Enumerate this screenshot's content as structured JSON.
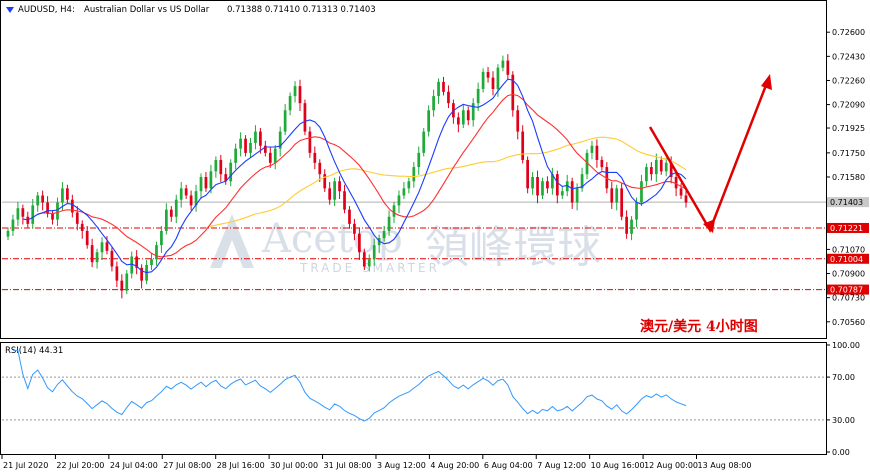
{
  "header": {
    "symbol": "AUDUSD, H4:",
    "description": "Australian Dollar vs US Dollar",
    "ohlc": "0.71388 0.71410 0.71313 0.71403"
  },
  "watermark": {
    "brand_en": "Acetop",
    "brand_cn": "領峰環球",
    "tagline": "TRADE SMARTER"
  },
  "annotation": "澳元/美元  4小时图",
  "colors": {
    "bull": "#26a69a",
    "bull_body": "#1faa3a",
    "bear": "#e0001a",
    "ma_fast": "#1a3cff",
    "ma_mid": "#ff3030",
    "ma_slow": "#ffcc33",
    "rsi": "#3399ff",
    "level": "#e00000",
    "arrow": "#e00000"
  },
  "chart_data": {
    "type": "candlestick",
    "symbol": "AUDUSD",
    "timeframe": "H4",
    "y_ticks": [
      "0.72600",
      "0.72430",
      "0.72260",
      "0.72090",
      "0.71925",
      "0.71750",
      "0.71580",
      "0.71070",
      "0.70900",
      "0.70730",
      "0.70560"
    ],
    "ylim": [
      0.7046,
      0.727
    ],
    "current_price": "0.71403",
    "levels": [
      {
        "value": 0.71221,
        "label": "0.71221"
      },
      {
        "value": 0.71004,
        "label": "0.71004"
      },
      {
        "value": 0.70787,
        "label": "0.70787"
      }
    ],
    "x_labels": [
      "21 Jul 2020",
      "22 Jul 20:00",
      "24 Jul 04:00",
      "27 Jul 08:00",
      "28 Jul 16:00",
      "30 Jul 00:00",
      "31 Jul 08:00",
      "3 Aug 12:00",
      "4 Aug 20:00",
      "6 Aug 04:00",
      "7 Aug 12:00",
      "10 Aug 16:00",
      "12 Aug 00:00",
      "13 Aug 08:00"
    ],
    "closes": [
      0.712,
      0.7128,
      0.7136,
      0.713,
      0.7125,
      0.7138,
      0.7145,
      0.714,
      0.7132,
      0.7128,
      0.714,
      0.715,
      0.7142,
      0.7133,
      0.7125,
      0.712,
      0.711,
      0.7098,
      0.7105,
      0.7112,
      0.7106,
      0.7095,
      0.7085,
      0.7078,
      0.709,
      0.7102,
      0.7094,
      0.7085,
      0.7096,
      0.71,
      0.711,
      0.712,
      0.7135,
      0.713,
      0.7142,
      0.715,
      0.7145,
      0.7138,
      0.7148,
      0.7158,
      0.715,
      0.7162,
      0.717,
      0.716,
      0.7155,
      0.7168,
      0.7178,
      0.7185,
      0.7175,
      0.7182,
      0.719,
      0.718,
      0.7175,
      0.7168,
      0.7178,
      0.719,
      0.7205,
      0.7215,
      0.7222,
      0.721,
      0.719,
      0.7175,
      0.7168,
      0.716,
      0.715,
      0.7142,
      0.7155,
      0.7148,
      0.7135,
      0.7125,
      0.7118,
      0.7105,
      0.7095,
      0.71,
      0.711,
      0.7115,
      0.712,
      0.713,
      0.7138,
      0.7145,
      0.715,
      0.7155,
      0.7165,
      0.7175,
      0.719,
      0.7205,
      0.7215,
      0.7225,
      0.7218,
      0.721,
      0.72,
      0.7195,
      0.7205,
      0.7198,
      0.721,
      0.722,
      0.7232,
      0.7228,
      0.722,
      0.7235,
      0.724,
      0.723,
      0.7205,
      0.719,
      0.717,
      0.715,
      0.7158,
      0.7145,
      0.7155,
      0.715,
      0.716,
      0.7145,
      0.7148,
      0.7155,
      0.714,
      0.715,
      0.716,
      0.7175,
      0.718,
      0.717,
      0.7165,
      0.715,
      0.714,
      0.715,
      0.713,
      0.7118,
      0.7128,
      0.714,
      0.7155,
      0.7165,
      0.716,
      0.717,
      0.7162,
      0.7168,
      0.7158,
      0.715,
      0.7145,
      0.714
    ],
    "rsi": {
      "label": "RSI(14) 44.31",
      "levels": [
        70,
        30
      ],
      "y_ticks": [
        "100.00",
        "70.00",
        "30.00",
        "0.00"
      ],
      "ylim": [
        0,
        100
      ]
    },
    "indicators": [
      "MA fast (blue)",
      "MA medium (red)",
      "MA slow (yellow)"
    ]
  }
}
